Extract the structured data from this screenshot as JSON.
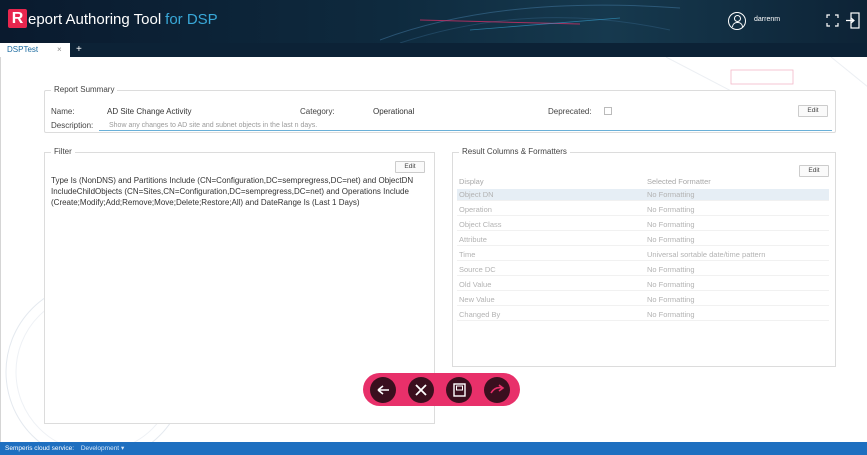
{
  "app": {
    "logo_letter": "R",
    "title": "eport Authoring Tool",
    "title_suffix": "for DSP",
    "brand_color": "#e8264e",
    "accent_color": "#39a8d8"
  },
  "header": {
    "username": "darrenm",
    "user_icon": "user-circle-icon",
    "expand_icon": "expand-icon",
    "exit_icon": "exit-door-icon"
  },
  "tabs": [
    {
      "label": "DSPTest",
      "close": "×"
    }
  ],
  "tab_add": "+",
  "summary": {
    "title": "Report Summary",
    "name_label": "Name:",
    "name_value": "AD Site Change Activity",
    "category_label": "Category:",
    "category_value": "Operational",
    "deprecated_label": "Deprecated:",
    "description_label": "Description:",
    "description_value": "Show any changes to AD site and subnet objects in the last n days.",
    "edit_label": "Edit"
  },
  "filter": {
    "title": "Filter",
    "edit_label": "Edit",
    "text": "Type Is (NonDNS) and Partitions Include (CN=Configuration,DC=sempregress,DC=net) and ObjectDN IncludeChildObjects (CN=Sites,CN=Configuration,DC=sempregress,DC=net) and Operations Include (Create;Modify;Add;Remove;Move;Delete;Restore;All) and DateRange Is (Last 1 Days)"
  },
  "results": {
    "title": "Result Columns & Formatters",
    "edit_label": "Edit",
    "headers": [
      "Display",
      "Selected Formatter"
    ],
    "rows": [
      [
        "Object DN",
        "No Formatting"
      ],
      [
        "Operation",
        "No Formatting"
      ],
      [
        "Object Class",
        "No Formatting"
      ],
      [
        "Attribute",
        "No Formatting"
      ],
      [
        "Time",
        "Universal sortable date/time pattern"
      ],
      [
        "Source DC",
        "No Formatting"
      ],
      [
        "Old Value",
        "No Formatting"
      ],
      [
        "New Value",
        "No Formatting"
      ],
      [
        "Changed By",
        "No Formatting"
      ]
    ]
  },
  "actions": {
    "back_icon": "back-arrow-icon",
    "cancel_icon": "close-icon",
    "save_icon": "save-icon",
    "run_icon": "forward-arrow-icon",
    "bar_color": "#e8306a"
  },
  "status": {
    "label": "Semperis cloud service:",
    "env_value": "Development",
    "env_icon": "dropdown-caret-icon"
  }
}
